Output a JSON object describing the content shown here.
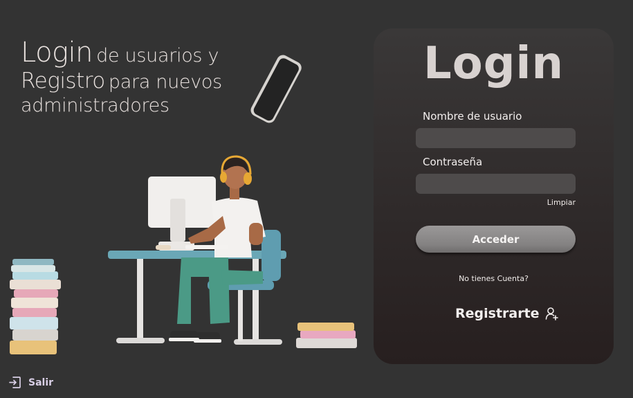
{
  "headline": {
    "login_word": "Login",
    "login_rest": "de usuarios  y",
    "registro_word": "Registro",
    "registro_rest": "para nuevos",
    "line3": "administradores"
  },
  "card": {
    "title": "Login",
    "username_label": "Nombre de usuario",
    "username_value": "",
    "password_label": "Contraseña",
    "password_value": "",
    "clear_label": "Limpiar",
    "submit_label": "Acceder",
    "no_account_text": "No tienes Cuenta?",
    "register_label": "Registrarte"
  },
  "footer": {
    "exit_label": "Salir"
  },
  "colors": {
    "page_bg": "#333333",
    "card_bg": "#2f2a2a",
    "input_bg": "#4e4b4b",
    "button_bg": "#8a8888",
    "exit_accent": "#d9cfe6"
  },
  "icons": {
    "register": "user-plus-icon",
    "exit": "logout-icon"
  }
}
